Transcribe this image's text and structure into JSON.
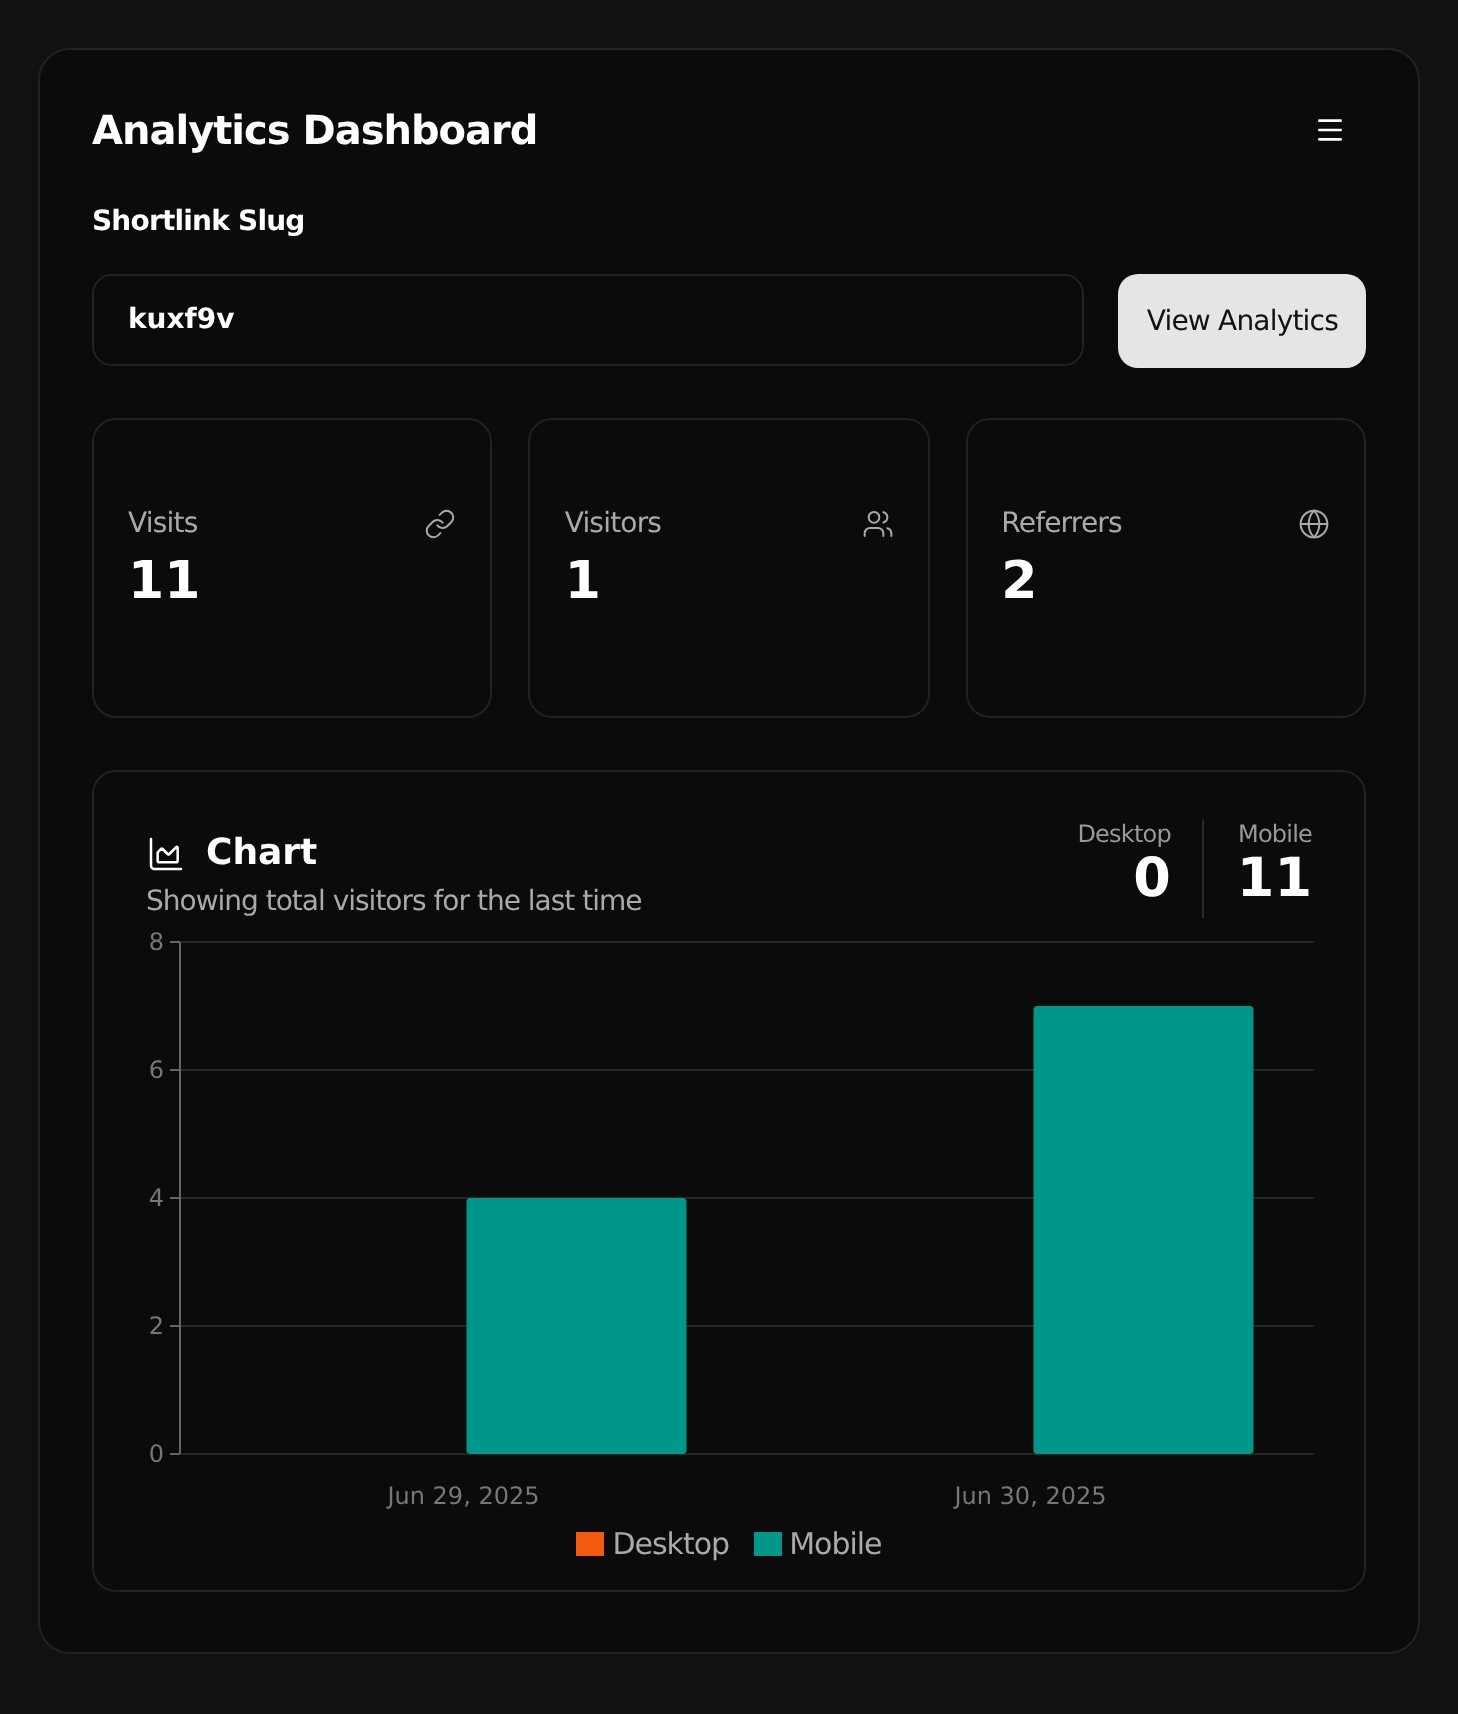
{
  "header": {
    "title": "Analytics Dashboard"
  },
  "slug": {
    "label": "Shortlink Slug",
    "value": "kuxf9v",
    "button": "View Analytics"
  },
  "stats": [
    {
      "label": "Visits",
      "value": "11"
    },
    {
      "label": "Visitors",
      "value": "1"
    },
    {
      "label": "Referrers",
      "value": "2"
    }
  ],
  "chart_card": {
    "title": "Chart",
    "subtitle": "Showing total visitors for the last time",
    "totals": [
      {
        "label": "Desktop",
        "value": "0"
      },
      {
        "label": "Mobile",
        "value": "11"
      }
    ],
    "chart_data": {
      "type": "bar",
      "categories": [
        "Jun 29, 2025",
        "Jun 30, 2025"
      ],
      "series": [
        {
          "name": "Desktop",
          "color": "#f25a0f",
          "values": [
            0,
            0
          ]
        },
        {
          "name": "Mobile",
          "color": "#00968a",
          "values": [
            4,
            7
          ]
        }
      ],
      "ylim": [
        0,
        8
      ],
      "yticks": [
        0,
        2,
        4,
        6,
        8
      ],
      "grid": true
    }
  }
}
